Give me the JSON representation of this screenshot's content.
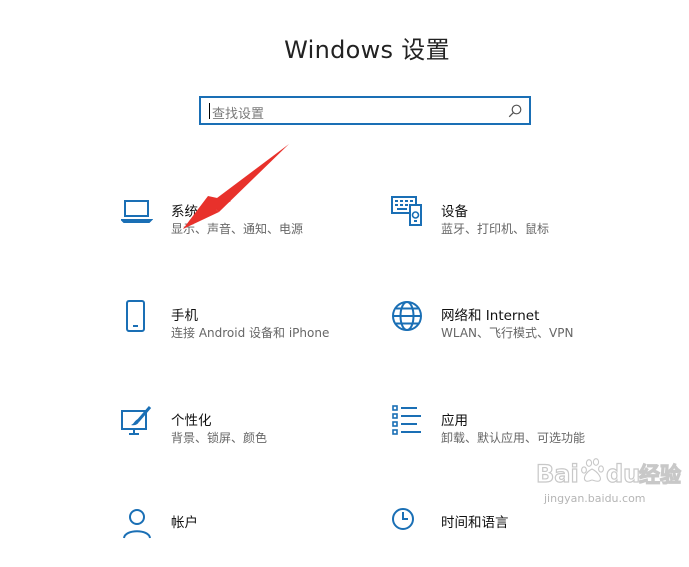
{
  "window": {
    "title": "Windows 设置"
  },
  "search": {
    "placeholder": "查找设置"
  },
  "tiles": [
    {
      "name": "系统",
      "desc": "显示、声音、通知、电源",
      "icon": "laptop-icon"
    },
    {
      "name": "设备",
      "desc": "蓝牙、打印机、鼠标",
      "icon": "keyboard-device-icon"
    },
    {
      "name": "手机",
      "desc": "连接 Android 设备和 iPhone",
      "icon": "phone-icon"
    },
    {
      "name": "网络和 Internet",
      "desc": "WLAN、飞行模式、VPN",
      "icon": "globe-icon"
    },
    {
      "name": "个性化",
      "desc": "背景、锁屏、颜色",
      "icon": "paint-brush-icon"
    },
    {
      "name": "应用",
      "desc": "卸载、默认应用、可选功能",
      "icon": "apps-list-icon"
    },
    {
      "name": "帐户",
      "desc": "",
      "icon": "account-icon"
    },
    {
      "name": "时间和语言",
      "desc": "",
      "icon": "time-language-icon"
    }
  ],
  "watermark": {
    "brand": "Bai",
    "brand2": "du",
    "cn": "经验",
    "url": "jingyan.baidu.com"
  },
  "colors": {
    "accent": "#1a6fb5",
    "arrow": "#e8312b"
  }
}
